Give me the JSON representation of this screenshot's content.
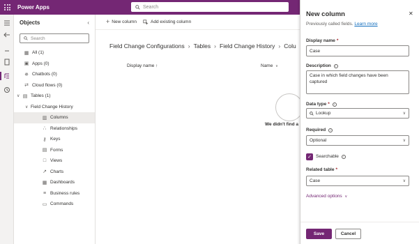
{
  "app": {
    "brand": "Power Apps"
  },
  "top_search": {
    "placeholder": "Search"
  },
  "objects_panel": {
    "title": "Objects",
    "search_placeholder": "Search",
    "items": [
      {
        "label": "All  (1)",
        "icon": "grid-icon"
      },
      {
        "label": "Apps  (0)",
        "icon": "apps-icon"
      },
      {
        "label": "Chatbots  (0)",
        "icon": "chatbot-icon"
      },
      {
        "label": "Cloud flows  (0)",
        "icon": "flow-icon"
      },
      {
        "label": "Tables  (1)",
        "icon": "table-icon"
      },
      {
        "label": "Field Change History"
      },
      {
        "label": "Columns",
        "icon": "columns-icon"
      },
      {
        "label": "Relationships",
        "icon": "relationships-icon"
      },
      {
        "label": "Keys",
        "icon": "key-icon"
      },
      {
        "label": "Forms",
        "icon": "form-icon"
      },
      {
        "label": "Views",
        "icon": "view-icon"
      },
      {
        "label": "Charts",
        "icon": "chart-icon"
      },
      {
        "label": "Dashboards",
        "icon": "dashboard-icon"
      },
      {
        "label": "Business rules",
        "icon": "business-rule-icon"
      },
      {
        "label": "Commands",
        "icon": "command-icon"
      }
    ]
  },
  "commandbar": {
    "new_column": "New column",
    "add_existing": "Add existing column"
  },
  "breadcrumb": [
    "Field Change Configurations",
    "Tables",
    "Field Change History",
    "Colu"
  ],
  "grid": {
    "col_display_name": "Display name ↑",
    "col_name": "Name",
    "empty_text": "We didn't find a"
  },
  "panel": {
    "title": "New column",
    "subtitle": "Previously called fields.",
    "learn_more": "Learn more",
    "display_name_label": "Display name",
    "display_name_value": "Case",
    "description_label": "Description",
    "description_value": "Case in which field changes have been captured",
    "data_type_label": "Data type",
    "data_type_value": "Lookup",
    "required_label": "Required",
    "required_value": "Optional",
    "searchable_label": "Searchable",
    "searchable_checked": true,
    "related_table_label": "Related table",
    "related_table_value": "Case",
    "advanced_options": "Advanced options",
    "save": "Save",
    "cancel": "Cancel"
  },
  "colors": {
    "brand": "#742774",
    "link": "#0f6cbd"
  }
}
